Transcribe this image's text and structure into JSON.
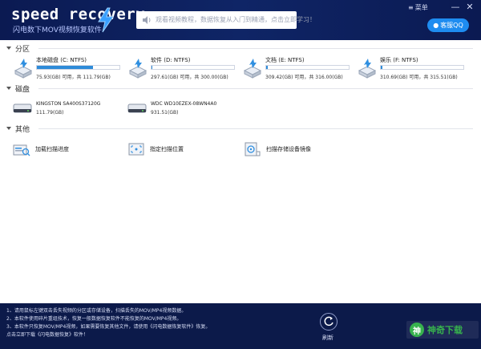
{
  "app": {
    "logo_text": "speed recovery",
    "subtitle": "闪电数下MOV视频恢复软件"
  },
  "header": {
    "notice_text": "观看视频教程，数据恢复从入门到精通，点击立即学习！",
    "menu_label": "菜单",
    "minimize_label": "—",
    "close_label": "✕",
    "qq_label": "客服QQ"
  },
  "sections": {
    "partitions": "分区",
    "disks": "磁盘",
    "other": "其他"
  },
  "partitions": [
    {
      "name": "本地磁盘 (C: NTFS)",
      "used_fraction": 0.68,
      "size_text": "75.93(GB) 可用，共 111.79(GB)"
    },
    {
      "name": "软件 (D: NTFS)",
      "used_fraction": 0.01,
      "size_text": "297.61(GB) 可用，共 300.00(GB)"
    },
    {
      "name": "文档 (E: NTFS)",
      "used_fraction": 0.02,
      "size_text": "309.42(GB) 可用，共 316.00(GB)"
    },
    {
      "name": "娱乐 (F: NTFS)",
      "used_fraction": 0.02,
      "size_text": "310.69(GB) 可用，共 315.51(GB)"
    }
  ],
  "disks": [
    {
      "name": "KINGSTON SA400S37120G",
      "size_text": "111.79(GB)"
    },
    {
      "name": "WDC WD10EZEX-08WN4A0",
      "size_text": "931.51(GB)"
    }
  ],
  "other_actions": [
    {
      "label": "加载扫描进度"
    },
    {
      "label": "指定扫描位置"
    },
    {
      "label": "扫描存储设备镜像"
    }
  ],
  "footer": {
    "tips": [
      "1、请用鼠标左键双击丢失视频的分区或存储设备，扫描丢失的MOV/MP4视频数据。",
      "2、本软件使用碎片重组技术，恢复一般数据恢复软件不能恢复的MOV/MP4视频。",
      "3、本软件只恢复MOV/MP4视频，如果需要恢复其他文件，请使用《闪电数据恢复软件》恢复。",
      "   点击立即下载《闪电数据恢复》软件！"
    ],
    "refresh_label": "刷新"
  },
  "watermark": {
    "logo": "神",
    "text": "神奇下载"
  },
  "colors": {
    "header_bg": "#0b1a52",
    "accent": "#2e8bd8",
    "qq_button": "#1e8cf0"
  }
}
